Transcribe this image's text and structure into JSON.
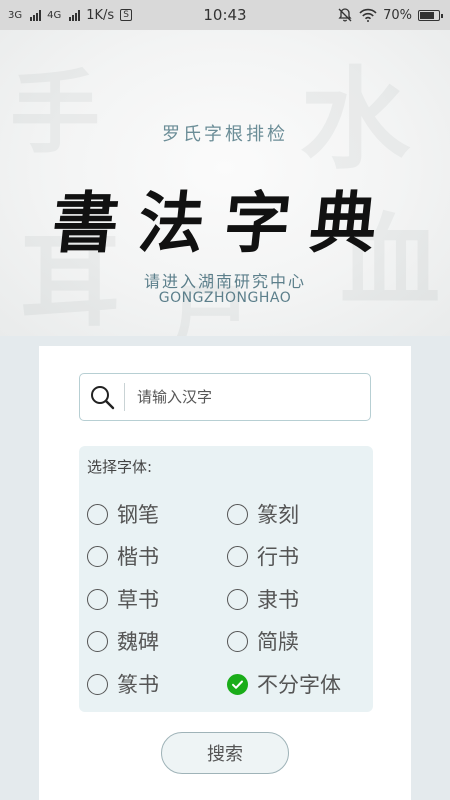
{
  "status_bar": {
    "net1": "3G",
    "net2": "4G",
    "speed": "1K/s",
    "speed_icon": "S",
    "time": "10:43",
    "battery": "70%"
  },
  "banner": {
    "subtitle": "罗氏字根排检",
    "calligraphy_title": "書法字典",
    "enter_line": "请进入湖南研究中心",
    "romanized": "GONGZHONGHAO"
  },
  "search": {
    "placeholder": "请输入汉字",
    "value": "",
    "button_label": "搜索"
  },
  "font_select": {
    "label": "选择字体:",
    "options": [
      {
        "label": "钢笔",
        "checked": false
      },
      {
        "label": "篆刻",
        "checked": false
      },
      {
        "label": "楷书",
        "checked": false
      },
      {
        "label": "行书",
        "checked": false
      },
      {
        "label": "草书",
        "checked": false
      },
      {
        "label": "隶书",
        "checked": false
      },
      {
        "label": "魏碑",
        "checked": false
      },
      {
        "label": "简牍",
        "checked": false
      },
      {
        "label": "篆书",
        "checked": false
      },
      {
        "label": "不分字体",
        "checked": true
      }
    ]
  },
  "colors": {
    "accent_teal": "#6b8d97",
    "checked_green": "#1aad19",
    "panel_bg": "#e9f2f4"
  }
}
